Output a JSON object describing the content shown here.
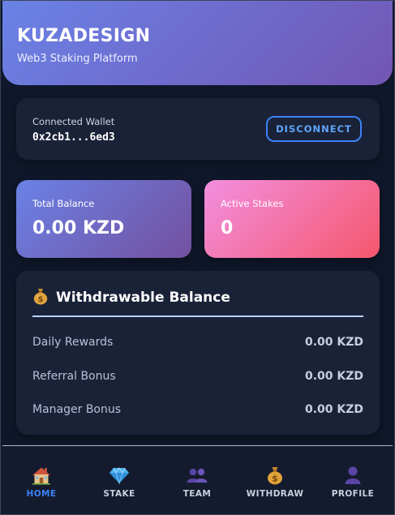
{
  "header": {
    "brand": "KUZADESIGN",
    "tagline": "Web3 Staking Platform"
  },
  "wallet": {
    "label": "Connected Wallet",
    "address": "0x2cb1...6ed3",
    "disconnect_label": "DISCONNECT"
  },
  "stats": {
    "total_balance_label": "Total Balance",
    "total_balance_value": "0.00 KZD",
    "active_stakes_label": "Active Stakes",
    "active_stakes_value": "0"
  },
  "withdrawable": {
    "icon": "money-bag-icon",
    "title": "Withdrawable Balance",
    "rows": [
      {
        "label": "Daily Rewards",
        "value": "0.00 KZD"
      },
      {
        "label": "Referral Bonus",
        "value": "0.00 KZD"
      },
      {
        "label": "Manager Bonus",
        "value": "0.00 KZD"
      }
    ]
  },
  "nav": {
    "items": [
      {
        "label": "HOME",
        "icon": "house-icon",
        "active": true
      },
      {
        "label": "STAKE",
        "icon": "gem-icon",
        "active": false
      },
      {
        "label": "TEAM",
        "icon": "team-icon",
        "active": false
      },
      {
        "label": "WITHDRAW",
        "icon": "money-bag-icon",
        "active": false
      },
      {
        "label": "PROFILE",
        "icon": "user-icon",
        "active": false
      }
    ]
  },
  "colors": {
    "accent": "#3b82f6",
    "background": "#0f172a",
    "card": "#1a2238",
    "header_gradient_start": "#6a82e6",
    "header_gradient_end": "#7256b3",
    "stakes_gradient_start": "#f28fe0",
    "stakes_gradient_end": "#f5576c"
  }
}
